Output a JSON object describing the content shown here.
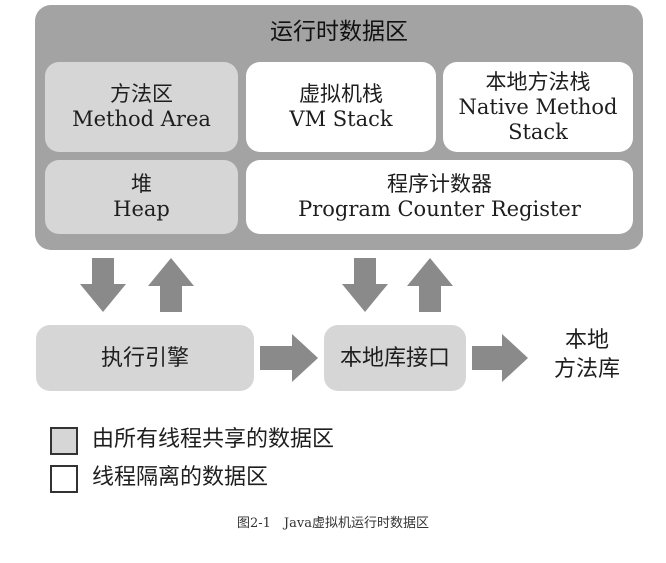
{
  "runtime_area": {
    "title": "运行时数据区"
  },
  "method_area": {
    "cn": "方法区",
    "en": "Method Area"
  },
  "vm_stack": {
    "cn": "虚拟机栈",
    "en": "VM Stack"
  },
  "native_method_stack": {
    "cn": "本地方法栈",
    "en_line1": "Native Method",
    "en_line2": "Stack"
  },
  "heap": {
    "cn": "堆",
    "en": "Heap"
  },
  "program_counter": {
    "cn": "程序计数器",
    "en": "Program Counter Register"
  },
  "execution_engine": {
    "label": "执行引擎"
  },
  "native_interface": {
    "label": "本地库接口"
  },
  "native_library": {
    "line1": "本地",
    "line2": "方法库"
  },
  "legend": {
    "shared": "由所有线程共享的数据区",
    "private": "线程隔离的数据区"
  },
  "caption": "图2-1　Java虚拟机运行时数据区",
  "colors": {
    "outer": "#a3a3a3",
    "shared_box": "#d6d6d6",
    "private_box": "#ffffff",
    "arrow": "#8a8a8a"
  }
}
